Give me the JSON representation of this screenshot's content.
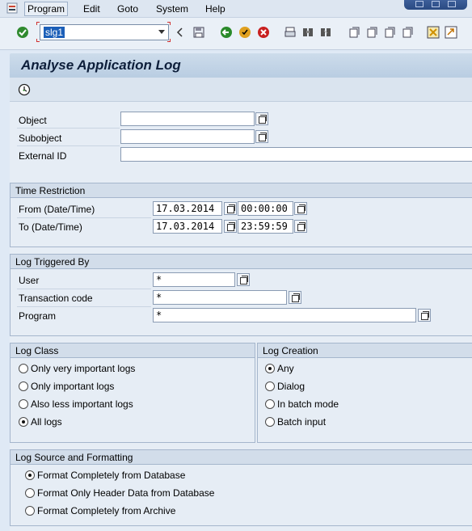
{
  "menu": {
    "items": [
      "Program",
      "Edit",
      "Goto",
      "System",
      "Help"
    ]
  },
  "toolbar": {
    "command_value": "slg1",
    "icons": [
      "enter-icon",
      "save-icon",
      "back-icon",
      "exit-icon",
      "cancel-icon",
      "print-icon",
      "find-icon",
      "find-next-icon",
      "first-page-icon",
      "previous-page-icon",
      "next-page-icon",
      "last-page-icon",
      "create-session-icon",
      "shortcut-icon"
    ]
  },
  "page": {
    "title": "Analyse Application Log",
    "execute_icon": "execute-icon"
  },
  "object_block": {
    "object_label": "Object",
    "object_value": "",
    "subobject_label": "Subobject",
    "subobject_value": "",
    "external_id_label": "External ID",
    "external_id_value": ""
  },
  "time_restriction": {
    "title": "Time Restriction",
    "from_label": "From (Date/Time)",
    "from_date": "17.03.2014",
    "from_time": "00:00:00",
    "to_label": "To (Date/Time)",
    "to_date": "17.03.2014",
    "to_time": "23:59:59"
  },
  "log_triggered_by": {
    "title": "Log Triggered By",
    "user_label": "User",
    "user_value": "*",
    "tcode_label": "Transaction code",
    "tcode_value": "*",
    "program_label": "Program",
    "program_value": "*"
  },
  "log_class": {
    "title": "Log Class",
    "options": [
      "Only very important logs",
      "Only important logs",
      "Also less important logs",
      "All logs"
    ],
    "selected": "All logs"
  },
  "log_creation": {
    "title": "Log Creation",
    "options": [
      "Any",
      "Dialog",
      "In batch mode",
      "Batch input"
    ],
    "selected": "Any"
  },
  "log_source": {
    "title": "Log Source and Formatting",
    "options": [
      "Format Completely from Database",
      "Format Only Header Data from Database",
      "Format Completely from Archive"
    ],
    "selected": "Format Completely from Database"
  },
  "colors": {
    "title_text": "#0d1e3a",
    "selection": "#1c5fb8",
    "background": "#e6edf5"
  }
}
